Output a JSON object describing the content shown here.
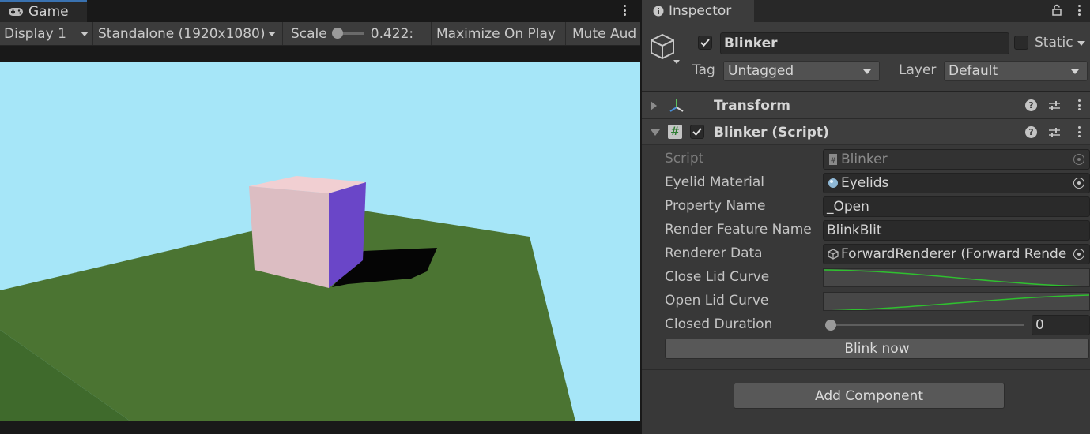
{
  "game": {
    "tab_label": "Game",
    "display": "Display 1",
    "resolution": "Standalone (1920x1080)",
    "scale_label": "Scale",
    "scale_value": "0.422:",
    "maximize_label": "Maximize On Play",
    "mute_label": "Mute Aud",
    "sky_color": "#a6e6f8",
    "ground_color": "#4b7432",
    "cube_colors": {
      "top": "#f1cfd2",
      "front": "#dcbdc2",
      "side": "#6a46c8"
    }
  },
  "inspector": {
    "tab_label": "Inspector",
    "object_enabled": true,
    "object_name": "Blinker",
    "static_label": "Static",
    "tag_label": "Tag",
    "tag_value": "Untagged",
    "layer_label": "Layer",
    "layer_value": "Default",
    "components": {
      "transform": {
        "title": "Transform"
      },
      "blinker": {
        "title": "Blinker (Script)",
        "enabled": true,
        "props": {
          "script": {
            "label": "Script",
            "value": "Blinker"
          },
          "eyelid_material": {
            "label": "Eyelid Material",
            "value": "Eyelids"
          },
          "property_name": {
            "label": "Property Name",
            "value": "_Open"
          },
          "render_feature_name": {
            "label": "Render Feature Name",
            "value": "BlinkBlit"
          },
          "renderer_data": {
            "label": "Renderer Data",
            "value": "ForwardRenderer (Forward Rende"
          },
          "close_lid_curve": {
            "label": "Close Lid Curve"
          },
          "open_lid_curve": {
            "label": "Open Lid Curve"
          },
          "closed_duration": {
            "label": "Closed Duration",
            "value": "0"
          }
        },
        "blink_button": "Blink now"
      }
    },
    "add_component": "Add Component"
  }
}
